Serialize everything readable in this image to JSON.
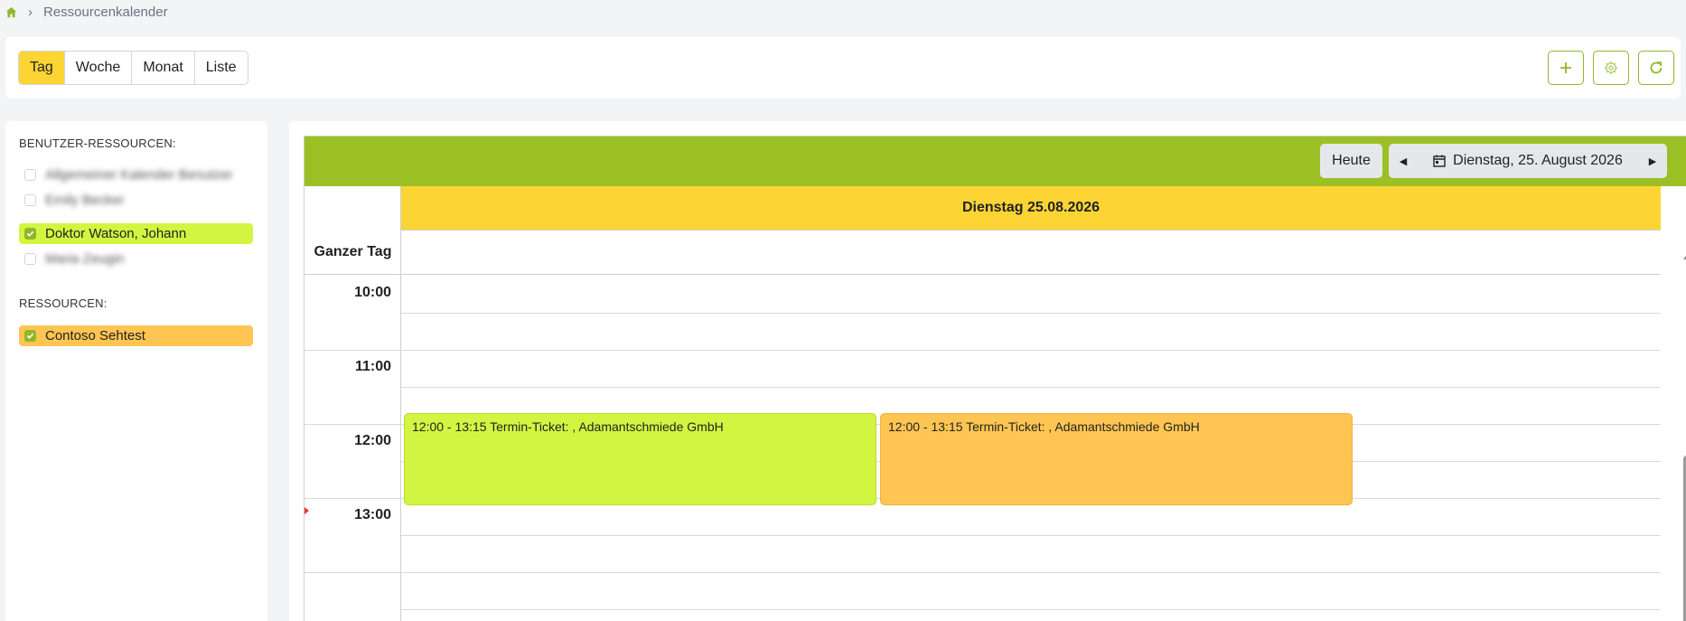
{
  "breadcrumb": {
    "icon": "home-icon",
    "separator": "›",
    "current": "Ressourcenkalender"
  },
  "toolbar": {
    "views": [
      {
        "label": "Tag",
        "active": true
      },
      {
        "label": "Woche",
        "active": false
      },
      {
        "label": "Monat",
        "active": false
      },
      {
        "label": "Liste",
        "active": false
      }
    ],
    "actions": [
      "plus-icon",
      "gear-icon",
      "refresh-icon"
    ],
    "accent_color": "#8fb829"
  },
  "sidebar": {
    "user_title": "BENUTZER-RESSOURCEN:",
    "users": [
      {
        "label": "Allgemeiner Kalender Benutzer",
        "checked": false,
        "obscured": true
      },
      {
        "label": "Emily Becker",
        "checked": false,
        "obscured": true
      },
      {
        "label": "Doktor Watson, Johann",
        "checked": true,
        "color": "#d2f542"
      },
      {
        "label": "Maria Zeugin",
        "checked": false,
        "obscured": true
      }
    ],
    "resources_title": "RESSOURCEN:",
    "resources": [
      {
        "label": "Contoso Sehtest",
        "checked": true,
        "color": "#ffc552"
      }
    ]
  },
  "calendar": {
    "header_color": "#9bc026",
    "today_button": "Heute",
    "date_label": "Dienstag, 25. August 2026",
    "day_heading": "Dienstag 25.08.2026",
    "allday_label": "Ganzer Tag",
    "times": [
      "10:00",
      "11:00",
      "12:00",
      "13:00"
    ],
    "events": [
      {
        "text": "12:00 - 13:15 Termin-Ticket: , Adamantschmiede GmbH",
        "color": "#d2f542"
      },
      {
        "text": "12:00 - 13:15 Termin-Ticket: , Adamantschmiede GmbH",
        "color": "#ffc552"
      }
    ]
  }
}
